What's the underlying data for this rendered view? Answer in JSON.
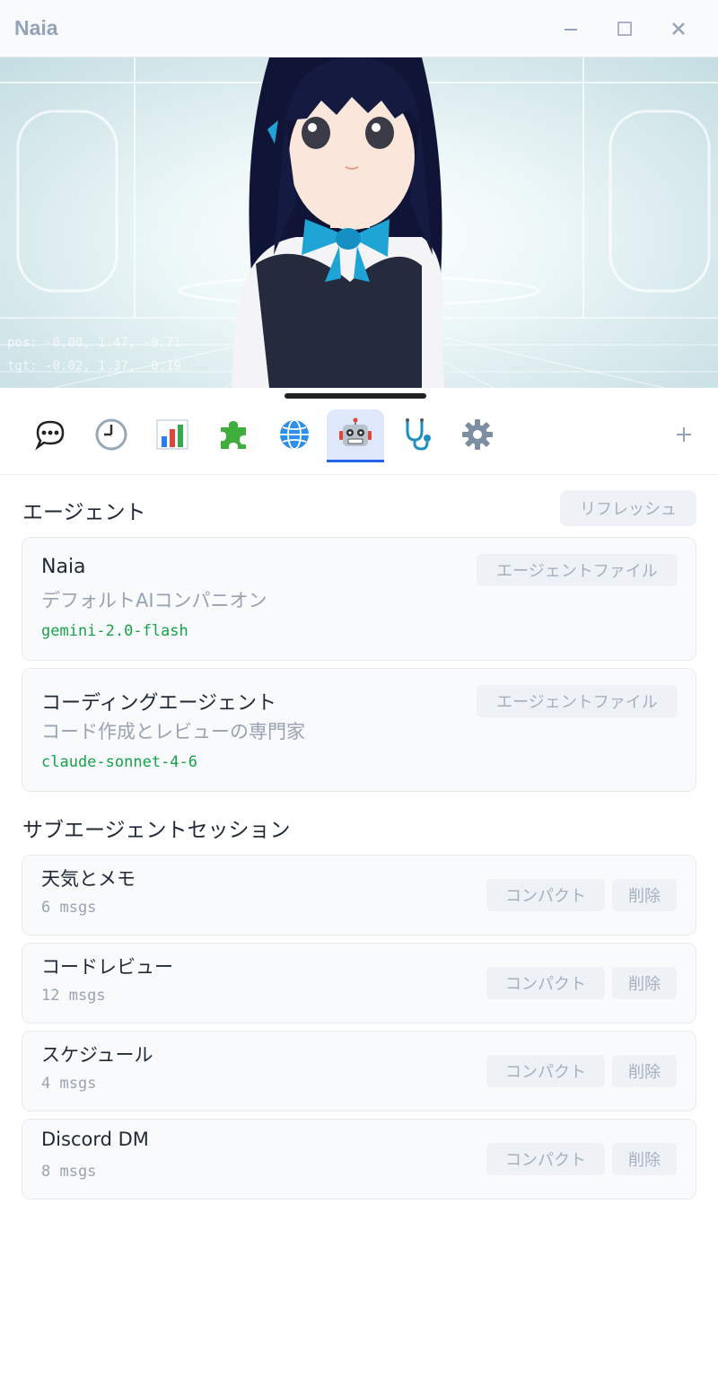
{
  "window": {
    "title": "Naia"
  },
  "viewport": {
    "debug_pos": "pos: -0.00, 1.47, -0.71",
    "debug_tgt": "tgt: -0.02, 1.37, -0.19"
  },
  "tabs": [
    {
      "icon": "chat-bubble-icon",
      "active": false
    },
    {
      "icon": "clock-icon",
      "active": false
    },
    {
      "icon": "bar-chart-icon",
      "active": false
    },
    {
      "icon": "puzzle-icon",
      "active": false
    },
    {
      "icon": "globe-icon",
      "active": false
    },
    {
      "icon": "robot-icon",
      "active": true
    },
    {
      "icon": "stethoscope-icon",
      "active": false
    },
    {
      "icon": "gear-icon",
      "active": false
    }
  ],
  "agents": {
    "title": "エージェント",
    "refresh_label": "リフレッシュ",
    "items": [
      {
        "name": "Naia",
        "desc": "デフォルトAIコンパニオン",
        "model": "gemini-2.0-flash",
        "file_label": "エージェントファイル"
      },
      {
        "name": "コーディングエージェント",
        "desc": "コード作成とレビューの専門家",
        "model": "claude-sonnet-4-6",
        "file_label": "エージェントファイル"
      }
    ]
  },
  "sessions": {
    "title": "サブエージェントセッション",
    "compact_label": "コンパクト",
    "delete_label": "削除",
    "items": [
      {
        "name": "天気とメモ",
        "count": "6 msgs"
      },
      {
        "name": "コードレビュー",
        "count": "12 msgs"
      },
      {
        "name": "スケジュール",
        "count": "4 msgs"
      },
      {
        "name": "Discord DM",
        "count": "8 msgs"
      }
    ]
  },
  "colors": {
    "accent": "#2563eb",
    "model_green": "#16a34a",
    "muted": "#98a3b3"
  }
}
